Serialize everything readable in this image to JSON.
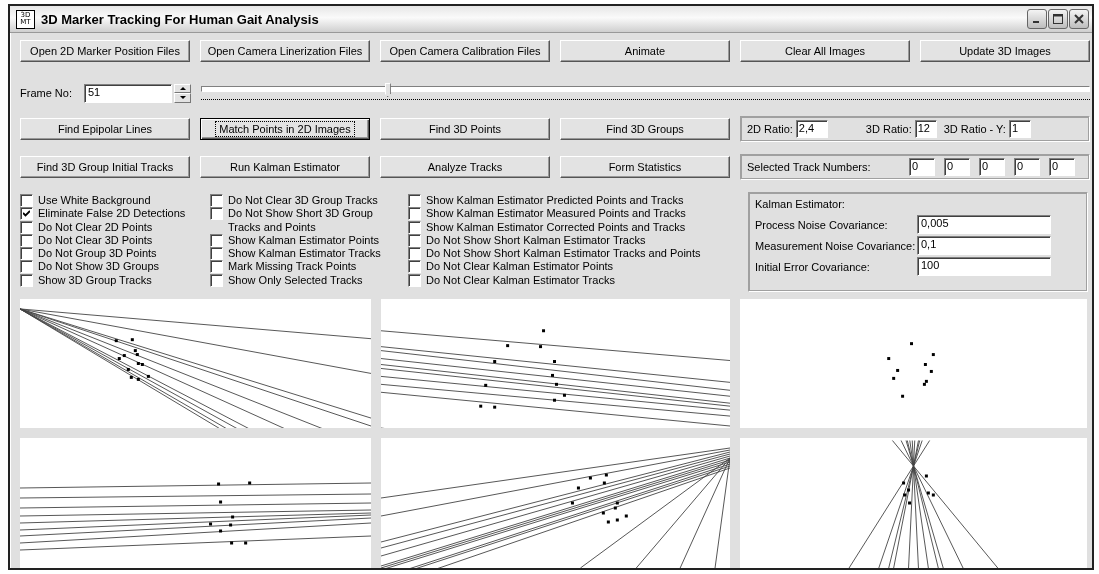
{
  "window": {
    "title": "3D Marker Tracking For Human Gait Analysis",
    "icon": {
      "top": "3D",
      "bottom": "MT"
    }
  },
  "button_row": [
    {
      "label": "Open 2D Marker Position Files",
      "focused": false
    },
    {
      "label": "Open Camera Linerization Files",
      "focused": false
    },
    {
      "label": "Open Camera Calibration Files",
      "focused": false
    },
    {
      "label": "Animate",
      "focused": false
    },
    {
      "label": "Clear All Images",
      "focused": false
    },
    {
      "label": "Update 3D Images",
      "focused": false
    }
  ],
  "frame": {
    "label": "Frame No:",
    "value": "51",
    "level": 0.21
  },
  "action_rows": [
    [
      {
        "label": "Find Epipolar Lines",
        "focused": false
      },
      {
        "label": "Match Points in 2D Images",
        "focused": true
      },
      {
        "label": "Find 3D Points",
        "focused": false
      },
      {
        "label": "Find 3D Groups",
        "focused": false
      }
    ],
    [
      {
        "label": "Find 3D Group Initial Tracks",
        "focused": false
      },
      {
        "label": "Run Kalman Estimator",
        "focused": false
      },
      {
        "label": "Analyze Tracks",
        "focused": false
      },
      {
        "label": "Form Statistics",
        "focused": false
      }
    ]
  ],
  "ratios": [
    {
      "label": "2D Ratio:",
      "value": "2,4"
    },
    {
      "label": "3D Ratio:",
      "value": "12"
    },
    {
      "label": "3D Ratio - Y:",
      "value": "1"
    }
  ],
  "selected_tracks": {
    "label": "Selected Track Numbers:",
    "values": [
      "0",
      "0",
      "0",
      "0",
      "0"
    ]
  },
  "options": [
    [
      {
        "label": "Use White Background",
        "checked": false
      },
      {
        "label": "Eliminate False 2D Detections",
        "checked": true
      },
      {
        "label": "Do Not Clear 2D Points",
        "checked": false
      },
      {
        "label": "Do Not Clear 3D Points",
        "checked": false
      },
      {
        "label": "Do Not Group 3D Points",
        "checked": false
      },
      {
        "label": "Do Not Show 3D Groups",
        "checked": false
      },
      {
        "label": "Show 3D Group Tracks",
        "checked": false
      }
    ],
    [
      {
        "label": "Do Not Clear 3D Group Tracks",
        "checked": false
      },
      {
        "label": "Do Not Show Short 3D Group Tracks and Points",
        "checked": false
      },
      {
        "label": "Show Kalman Estimator Points",
        "checked": false
      },
      {
        "label": "Show Kalman Estimator Tracks",
        "checked": false
      },
      {
        "label": "Mark Missing Track Points",
        "checked": false
      },
      {
        "label": "Show Only Selected Tracks",
        "checked": false
      }
    ],
    [
      {
        "label": "Show Kalman Estimator Predicted Points and Tracks",
        "checked": false
      },
      {
        "label": "Show Kalman Estimator Measured Points and Tracks",
        "checked": false
      },
      {
        "label": "Show Kalman Estimator Corrected Points and Tracks",
        "checked": false
      },
      {
        "label": "Do Not Show Short Kalman Estimator Tracks",
        "checked": false
      },
      {
        "label": "Do Not Show Short Kalman Estimator Tracks and Points",
        "checked": false
      },
      {
        "label": "Do Not Clear Kalman Estimator Points",
        "checked": false
      },
      {
        "label": "Do Not Clear Kalman Estimator Tracks",
        "checked": false
      }
    ]
  ],
  "kalman": {
    "title": "Kalman Estimator:",
    "fields": [
      {
        "label": "Process Noise Covariance:",
        "value": "0,005"
      },
      {
        "label": "Measurement Noise Covariance:",
        "value": "0,1"
      },
      {
        "label": "Initial Error Covariance:",
        "value": "100"
      }
    ]
  },
  "views": [
    {
      "kind": "lines"
    },
    {
      "kind": "lines"
    },
    {
      "kind": "points"
    },
    {
      "kind": "lines"
    },
    {
      "kind": "lines"
    },
    {
      "kind": "lines"
    }
  ]
}
